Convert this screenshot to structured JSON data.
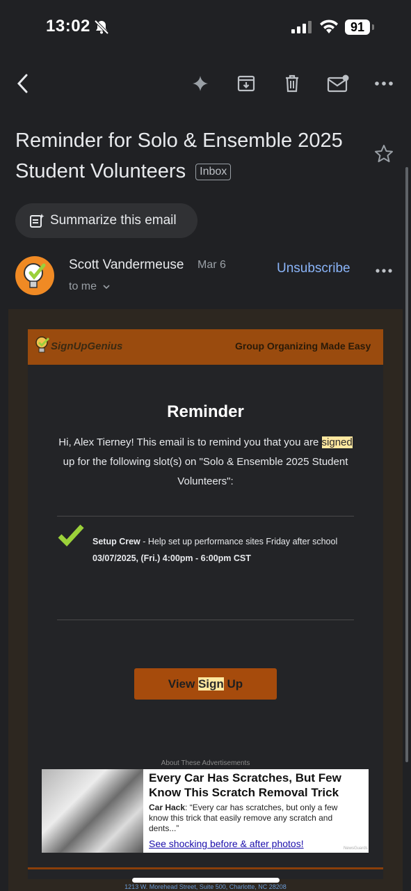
{
  "status_bar": {
    "time": "13:02",
    "battery": "91"
  },
  "email": {
    "subject": "Reminder for Solo & Ensemble 2025 Student Volunteers",
    "label": "Inbox",
    "summarize_label": "Summarize this email",
    "sender": "Scott Vandermeuse",
    "date": "Mar 6",
    "recipient": "to me",
    "unsubscribe": "Unsubscribe"
  },
  "body": {
    "logo": "SignUpGenius",
    "tagline": "Group Organizing Made Easy",
    "heading": "Reminder",
    "message_pre": "Hi, Alex Tierney! This email is to remind you that you are",
    "message_highlight": "signed",
    "message_post": "up for the following slot(s) on \"Solo & Ensemble 2025 Student Volunteers\":",
    "slot_title": "Setup Crew",
    "slot_desc": " - Help set up performance sites Friday after school",
    "slot_time": "03/07/2025, (Fri.) 4:00pm - 6:00pm CST",
    "button_pre": "View ",
    "button_highlight": "Sign",
    "button_post": " Up",
    "ad_about": "About These Advertisements",
    "ad_title": "Every Car Has Scratches, But Few Know This Scratch Removal Trick",
    "ad_desc_bold": "Car Hack",
    "ad_desc": ": “Every car has scratches, but only a few know this trick that easily remove any scratch and dents...”",
    "ad_link": "See shocking before & after photos!",
    "ad_badge": "NewsGuards",
    "footer_address": "1213 W. Morehead Street, Suite 500, Charlotte, NC 28208"
  },
  "colors": {
    "background": "#202124",
    "link": "#8ab4f8",
    "brand": "#9a4b0e",
    "button": "#a64b0c"
  }
}
